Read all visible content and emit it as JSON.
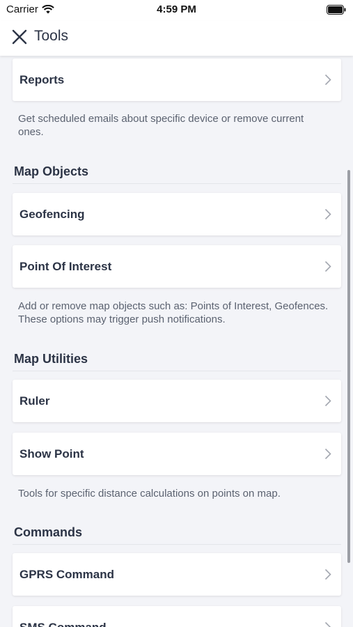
{
  "status_bar": {
    "carrier": "Carrier",
    "time": "4:59 PM"
  },
  "header": {
    "title": "Tools",
    "close_icon": "close-icon"
  },
  "sections": {
    "reports": {
      "items": [
        {
          "label": "Reports"
        }
      ],
      "description": "Get scheduled emails about specific device or remove current ones."
    },
    "map_objects": {
      "title": "Map Objects",
      "items": [
        {
          "label": "Geofencing"
        },
        {
          "label": "Point Of Interest"
        }
      ],
      "description": "Add or remove map objects such as: Points of Interest, Geofences. These options may trigger push notifications."
    },
    "map_utilities": {
      "title": "Map Utilities",
      "items": [
        {
          "label": "Ruler"
        },
        {
          "label": "Show Point"
        }
      ],
      "description": "Tools for specific distance calculations on points on map."
    },
    "commands": {
      "title": "Commands",
      "items": [
        {
          "label": "GPRS Command"
        },
        {
          "label": "SMS Command"
        }
      ]
    }
  },
  "colors": {
    "background": "#f3f4f8",
    "card": "#ffffff",
    "text": "#2c3446",
    "muted": "#5b6270"
  }
}
